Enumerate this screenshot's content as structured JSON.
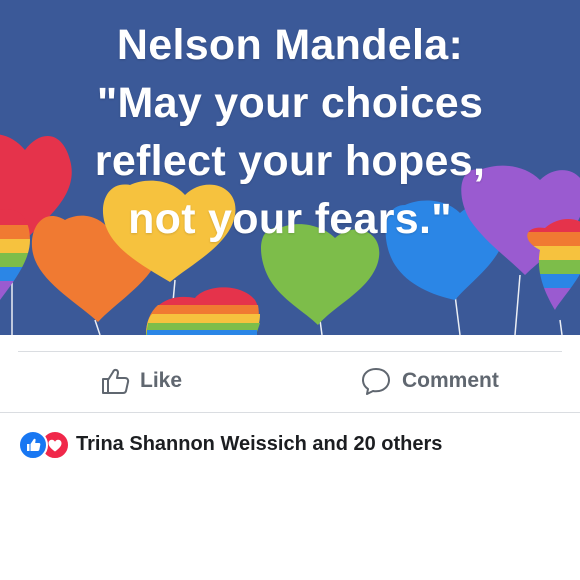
{
  "post": {
    "quote_lines": [
      "Nelson Mandela:",
      "\"May your choices",
      "reflect your hopes,",
      "not your fears.\""
    ]
  },
  "actions": {
    "like_label": "Like",
    "comment_label": "Comment"
  },
  "reactions": {
    "summary": "Trina Shannon Weissich and 20 others",
    "icons": [
      "like-reaction-icon",
      "love-reaction-icon"
    ]
  },
  "colors": {
    "banner_bg": "#3b5998",
    "action_text": "#606770",
    "like_blue": "#1877f2",
    "love_red": "#f0284a"
  }
}
